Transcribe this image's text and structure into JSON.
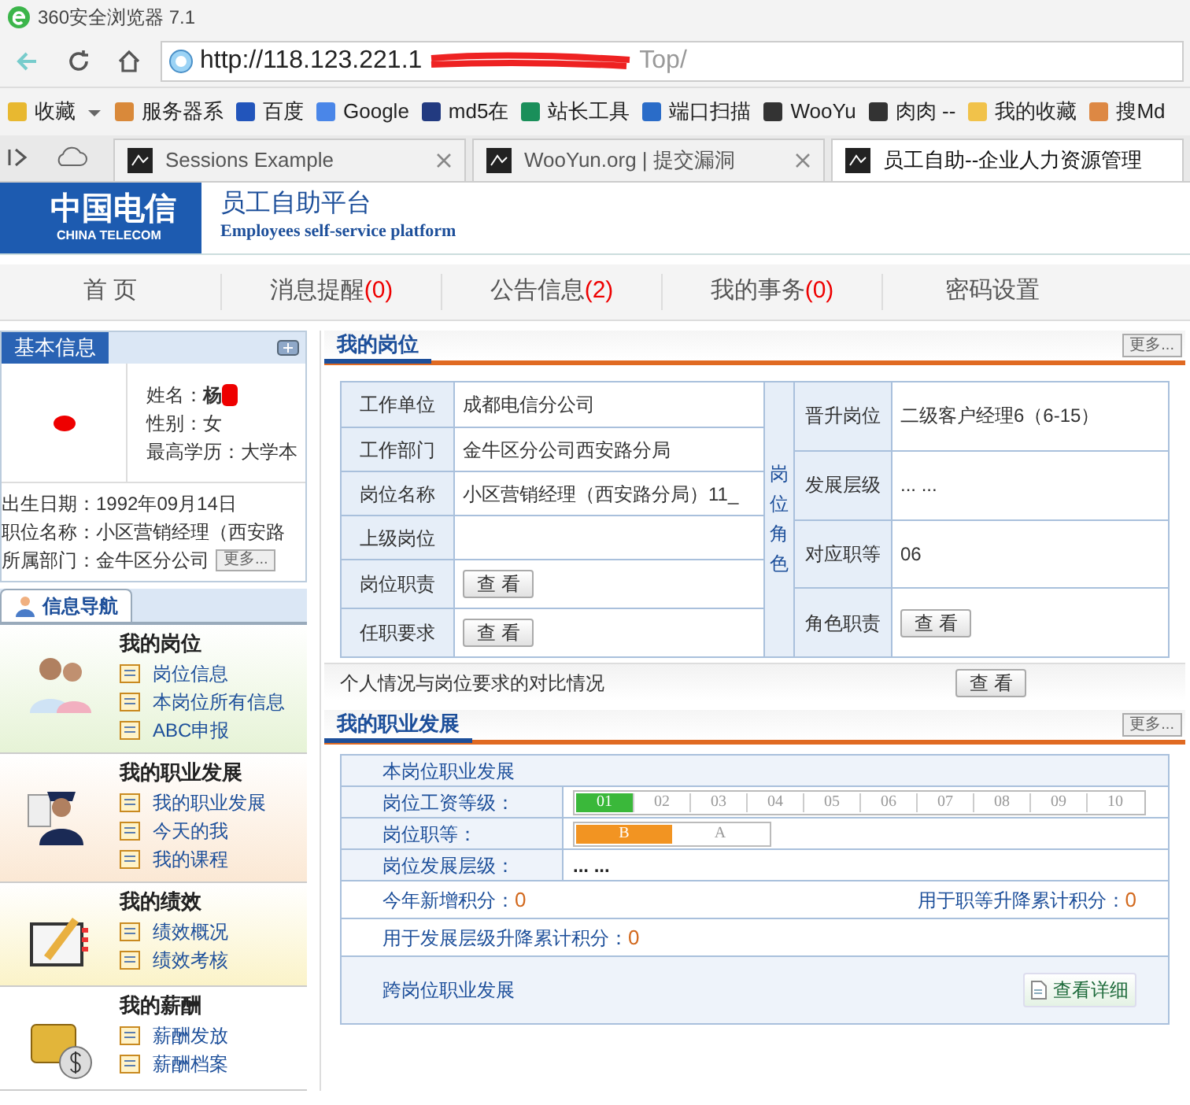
{
  "browser": {
    "title": "360安全浏览器 7.1",
    "url": "http://118.123.221.1",
    "url_tail": "Top/",
    "bookmarks": [
      {
        "label": "收藏"
      },
      {
        "label": "服务器系"
      },
      {
        "label": "百度"
      },
      {
        "label": "Google"
      },
      {
        "label": "md5在"
      },
      {
        "label": "站长工具"
      },
      {
        "label": "端口扫描"
      },
      {
        "label": "WooYu"
      },
      {
        "label": "肉肉 --"
      },
      {
        "label": "我的收藏"
      },
      {
        "label": "搜Md"
      }
    ],
    "tabs": [
      {
        "label": "Sessions Example",
        "selected": false
      },
      {
        "label": "WooYun.org | 提交漏洞",
        "selected": false
      },
      {
        "label": "员工自助--企业人力资源管理",
        "selected": true
      }
    ]
  },
  "header": {
    "logo_cn": "中国电信",
    "logo_en": "CHINA TELECOM",
    "title": "员工自助平台",
    "subtitle": "Employees self-service platform"
  },
  "nav": [
    {
      "label": "首 页"
    },
    {
      "label": "消息提醒",
      "count": "(0)"
    },
    {
      "label": "公告信息",
      "count": "(2)"
    },
    {
      "label": "我的事务",
      "count": "(0)"
    },
    {
      "label": "密码设置"
    }
  ],
  "basic_info": {
    "title": "基本信息",
    "fields": [
      {
        "label": "姓名：",
        "value": "杨"
      },
      {
        "label": "性别：",
        "value": "女"
      },
      {
        "label": "最高学历：",
        "value": "大学本"
      }
    ],
    "details": [
      "出生日期：1992年09月14日",
      "职位名称：小区营销经理（西安路",
      "所属部门：金牛区分公司"
    ],
    "more": "更多..."
  },
  "side_nav": {
    "title": "信息导航",
    "groups": [
      {
        "title": "我的岗位",
        "links": [
          "岗位信息",
          "本岗位所有信息",
          "ABC申报"
        ]
      },
      {
        "title": "我的职业发展",
        "links": [
          "我的职业发展",
          "今天的我",
          "我的课程"
        ]
      },
      {
        "title": "我的绩效",
        "links": [
          "绩效概况",
          "绩效考核"
        ]
      },
      {
        "title": "我的薪酬",
        "links": [
          "薪酬发放",
          "薪酬档案"
        ]
      }
    ]
  },
  "position": {
    "title": "我的岗位",
    "more": "更多...",
    "role_label": "岗位角色",
    "left_rows": [
      {
        "label": "工作单位",
        "kind": "text",
        "value": "成都电信分公司"
      },
      {
        "label": "工作部门",
        "kind": "text",
        "value": "金牛区分公司西安路分局"
      },
      {
        "label": "岗位名称",
        "kind": "text",
        "value": "小区营销经理（西安路分局）11_"
      },
      {
        "label": "上级岗位",
        "kind": "text"
      },
      {
        "label": "岗位职责",
        "kind": "button",
        "value": "查 看"
      },
      {
        "label": "任职要求",
        "kind": "button",
        "value": "查 看"
      }
    ],
    "right_rows": [
      {
        "label": "晋升岗位",
        "kind": "text",
        "value": "二级客户经理6（6-15）"
      },
      {
        "label": "发展层级",
        "kind": "text",
        "value": "... ..."
      },
      {
        "label": "对应职等",
        "kind": "text",
        "value": "06"
      },
      {
        "label": "角色职责",
        "kind": "button",
        "value": "查 看"
      }
    ],
    "compare_label": "个人情况与岗位要求的对比情况",
    "compare_button": "查 看"
  },
  "career": {
    "title": "我的职业发展",
    "more": "更多...",
    "section": "本岗位职业发展",
    "salary_label": "岗位工资等级：",
    "salary_grades": [
      {
        "label": "01",
        "selected": true
      },
      {
        "label": "02",
        "selected": false
      },
      {
        "label": "03",
        "selected": false
      },
      {
        "label": "04",
        "selected": false
      },
      {
        "label": "05",
        "selected": false
      },
      {
        "label": "06",
        "selected": false
      },
      {
        "label": "07",
        "selected": false
      },
      {
        "label": "08",
        "selected": false
      },
      {
        "label": "09",
        "selected": false
      },
      {
        "label": "10",
        "selected": false
      }
    ],
    "rank_label": "岗位职等：",
    "ranks": [
      {
        "label": "B",
        "selected": true
      },
      {
        "label": "A",
        "selected": false
      }
    ],
    "level_label": "岗位发展层级：",
    "level_value": "... ...",
    "points": [
      {
        "label": "今年新增积分：",
        "value": "0"
      },
      {
        "label": "用于职等升降累计积分：",
        "value": "0"
      },
      {
        "label": "用于发展层级升降累计积分：",
        "value": "0"
      }
    ],
    "cross_label": "跨岗位职业发展",
    "detail_button": "查看详细"
  }
}
